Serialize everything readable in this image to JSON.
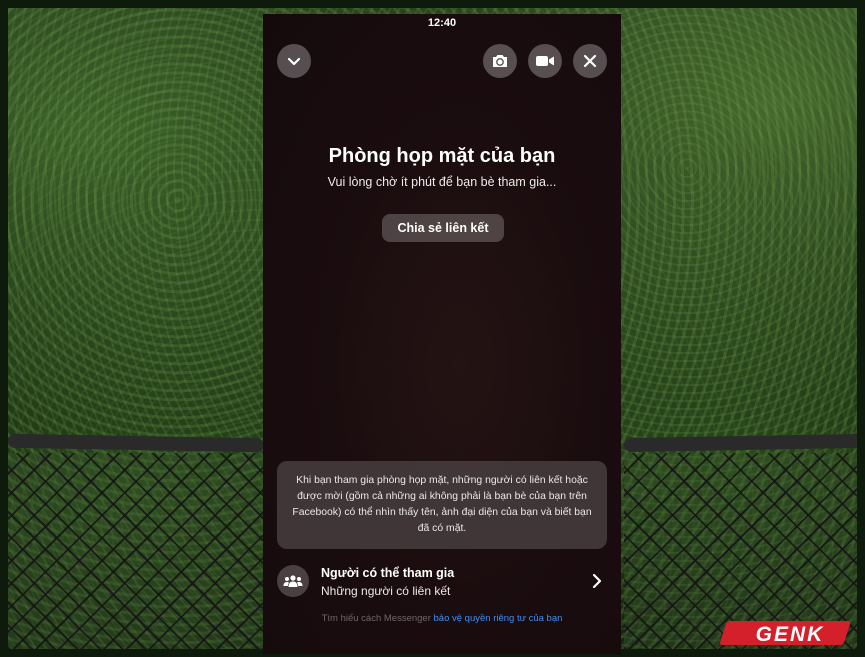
{
  "status": {
    "time": "12:40"
  },
  "header": {
    "collapse_icon": "chevron-down-icon",
    "flip_camera_icon": "camera-flip-icon",
    "video_icon": "video-camera-icon",
    "close_icon": "close-icon"
  },
  "room": {
    "title": "Phòng họp mặt của bạn",
    "subtitle": "Vui lòng chờ ít phút để bạn bè tham gia...",
    "share_button": "Chia sẻ liên kết"
  },
  "notice": {
    "text": "Khi bạn tham gia phòng họp mặt, những người có liên kết hoặc được mời (gồm cả những ai không phải là bạn bè của bạn trên Facebook) có thể nhìn thấy tên, ảnh đại diện của bạn và biết bạn đã có mặt."
  },
  "who_can_join": {
    "title": "Người có thể tham gia",
    "value": "Những người có liên kết",
    "icon": "people-icon"
  },
  "privacy": {
    "prefix": "Tìm hiểu cách Messenger ",
    "link": "bảo vệ quyền riêng tư của bạn"
  },
  "watermark": {
    "text": "GENK"
  },
  "colors": {
    "panel_bg": "#1b0d0f",
    "link": "#3f8df5",
    "logo_red": "#d4202a"
  }
}
